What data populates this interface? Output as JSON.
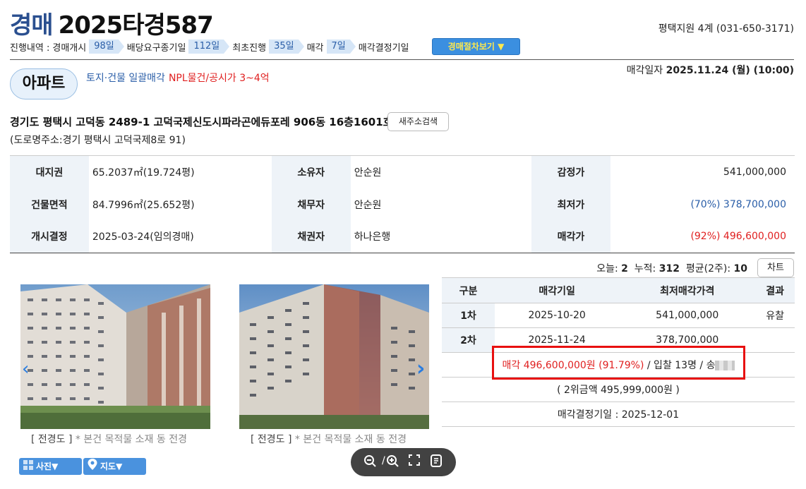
{
  "header": {
    "kind": "경매",
    "case_number": "2025타경587",
    "court": "평택지원 4계 (031-650-3171)"
  },
  "timeline": {
    "prefix": "진행내역 :",
    "steps": [
      {
        "label": "경매개시",
        "days": "98일"
      },
      {
        "label": "배당요구종기일",
        "days": "112일"
      },
      {
        "label": "최초진행",
        "days": "35일"
      },
      {
        "label": "매각",
        "days": "7일"
      }
    ],
    "last_step": "매각결정기일",
    "procedure_button": "경매절차보기 ▼"
  },
  "property": {
    "type_tag": "아파트",
    "sub_tag": "토지·건물 일괄매각",
    "npl_tag": "NPL물건/공시가 3~4억",
    "sale_date_label": "매각일자",
    "sale_date": "2025.11.24 (월) (10:00)",
    "address": "경기도 평택시 고덕동 2489-1 고덕국제신도시파라곤에듀포레 906동 16층1601호",
    "new_address_button": "새주소검색",
    "road_address": "(도로명주소:경기 평택시 고덕국제8로 91)"
  },
  "info": {
    "land_label": "대지권",
    "land": "65.2037㎡(19.724평)",
    "owner_label": "소유자",
    "owner": "안순원",
    "appraisal_label": "감정가",
    "appraisal": "541,000,000",
    "building_label": "건물면적",
    "building": "84.7996㎡(25.652평)",
    "debtor_label": "채무자",
    "debtor": "안순원",
    "min_label": "최저가",
    "min_price": "(70%) 378,700,000",
    "start_label": "개시결정",
    "start": "2025-03-24(임의경매)",
    "creditor_label": "채권자",
    "creditor": "하나은행",
    "sold_label": "매각가",
    "sold_price": "(92%) 496,600,000"
  },
  "stats": {
    "today_label": "오늘:",
    "today": "2",
    "total_label": "누적:",
    "total": "312",
    "avg_label": "평균(2주):",
    "avg": "10",
    "chart_button": "차트"
  },
  "photos": {
    "caption_title": "[ 전경도 ]",
    "caption_desc": "* 본건 목적물 소재 동 전경",
    "photo_button": "사진▼",
    "map_button": "지도▼"
  },
  "history": {
    "headers": [
      "구분",
      "매각기일",
      "최저매각가격",
      "결과"
    ],
    "rows": [
      {
        "round": "1차",
        "date": "2025-10-20",
        "price": "541,000,000",
        "result": "유찰"
      },
      {
        "round": "2차",
        "date": "2025-11-24",
        "price": "378,700,000",
        "result": ""
      }
    ],
    "sold_text": "매각 496,600,000원 (91.79%)",
    "sold_rest": "/ 입찰 13명 / 송",
    "second_bid": "( 2위금액 495,999,000원 )",
    "decision": "매각결정기일 : 2025-12-01"
  },
  "viewer": {
    "page_sep": "/"
  }
}
